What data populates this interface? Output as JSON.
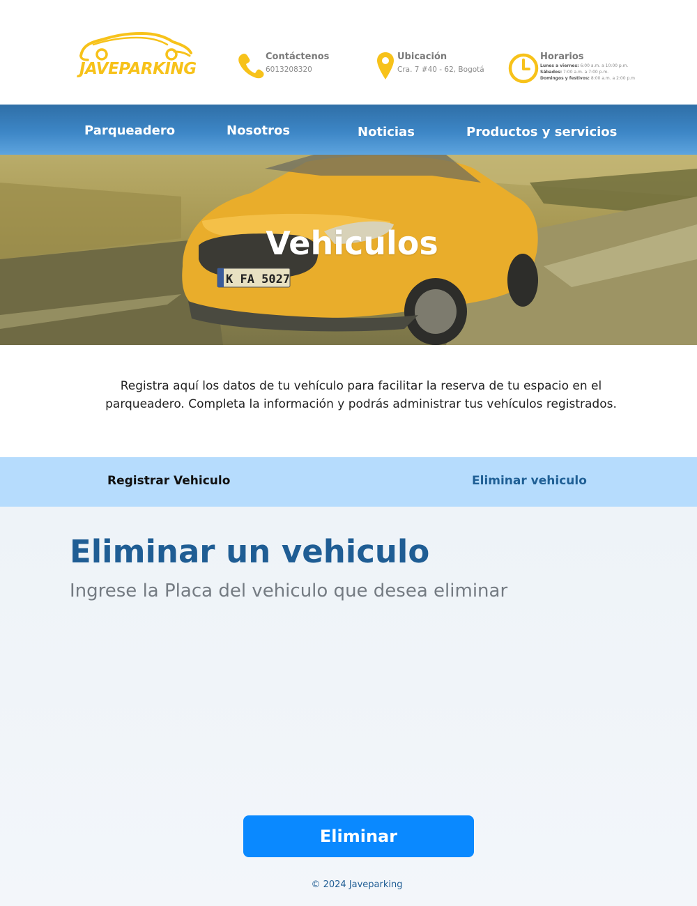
{
  "brand": {
    "name": "JAVEPARKING",
    "accent": "#f7c21a"
  },
  "header": {
    "contact": {
      "title": "Contáctenos",
      "value": "6013208320",
      "icon": "phone-icon"
    },
    "location": {
      "title": "Ubicación",
      "value": "Cra. 7 #40 - 62, Bogotá",
      "icon": "location-pin-icon"
    },
    "hours": {
      "title": "Horarios",
      "icon": "clock-icon",
      "rows": [
        {
          "label": "Lunes a viernes:",
          "value": "6:00 a.m. a 10:00 p.m."
        },
        {
          "label": "Sábados:",
          "value": "7:00 a.m. a 7:00 p.m."
        },
        {
          "label": "Domingos y festivos:",
          "value": "8:00 a.m. a 2:00 p.m"
        }
      ]
    }
  },
  "nav": {
    "items": [
      {
        "label": "Parqueadero"
      },
      {
        "label": "Nosotros"
      },
      {
        "label": "Noticias"
      },
      {
        "label": "Productos y servicios"
      }
    ]
  },
  "hero": {
    "title": "Vehiculos",
    "plate": "K FA 5027"
  },
  "intro": {
    "text": "Registra aquí los datos de tu vehículo para facilitar la reserva de tu espacio en el parqueadero. Completa la información y podrás administrar tus vehículos registrados."
  },
  "tabs": {
    "register": "Registrar Vehiculo",
    "delete": "Eliminar vehiculo"
  },
  "main": {
    "title": "Eliminar un vehiculo",
    "subtitle": "Ingrese la Placa del vehiculo que desea eliminar",
    "plate_value": "",
    "button_label": "Eliminar"
  },
  "footer": {
    "text": "© 2024 Javeparking"
  },
  "colors": {
    "nav": "#3d86c6",
    "tabs_bg": "#b6dcfd",
    "title": "#1f5d94",
    "button": "#0a89ff"
  }
}
